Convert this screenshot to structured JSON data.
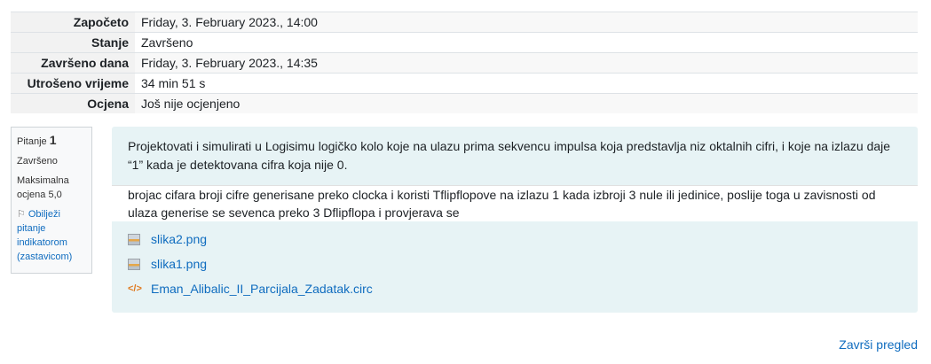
{
  "summary": {
    "rows": [
      {
        "label": "Započeto",
        "value": "Friday, 3. February 2023., 14:00"
      },
      {
        "label": "Stanje",
        "value": "Završeno"
      },
      {
        "label": "Završeno dana",
        "value": "Friday, 3. February 2023., 14:35"
      },
      {
        "label": "Utrošeno vrijeme",
        "value": "34 min 51 s"
      },
      {
        "label": "Ocjena",
        "value": "Još nije ocjenjeno"
      }
    ]
  },
  "question_info": {
    "label": "Pitanje",
    "number": "1",
    "status": "Završeno",
    "max_grade": "Maksimalna ocjena 5,0",
    "flag_label": "Obilježi pitanje indikatorom (zastavicom)",
    "flag_icon": "flag-icon"
  },
  "question": {
    "text": "Projektovati i simulirati u Logisimu logičko kolo koje na ulazu prima sekvencu impulsa koja predstavlja niz oktalnih cifri, i koje na izlazu daje “1” kada je detektovana cifra koja nije 0.",
    "answer": "brojac cifara broji cifre generisane preko clocka i koristi Tflipflopove na izlazu 1 kada izbroji 3 nule ili jedinice, poslije toga u zavisnosti od ulaza generise se sevenca preko 3 Dflipflopa i provjerava se",
    "attachments": [
      {
        "name": "slika2.png",
        "icon": "image-file-icon"
      },
      {
        "name": "slika1.png",
        "icon": "image-file-icon"
      },
      {
        "name": "Eman_Alibalic_II_Parcijala_Zadatak.circ",
        "icon": "code-file-icon"
      }
    ]
  },
  "footer": {
    "finish_review": "Završi pregled"
  },
  "colors": {
    "link": "#0f6cbf",
    "content_bg": "#e7f3f5",
    "label_bg": "#f2f2f2"
  }
}
